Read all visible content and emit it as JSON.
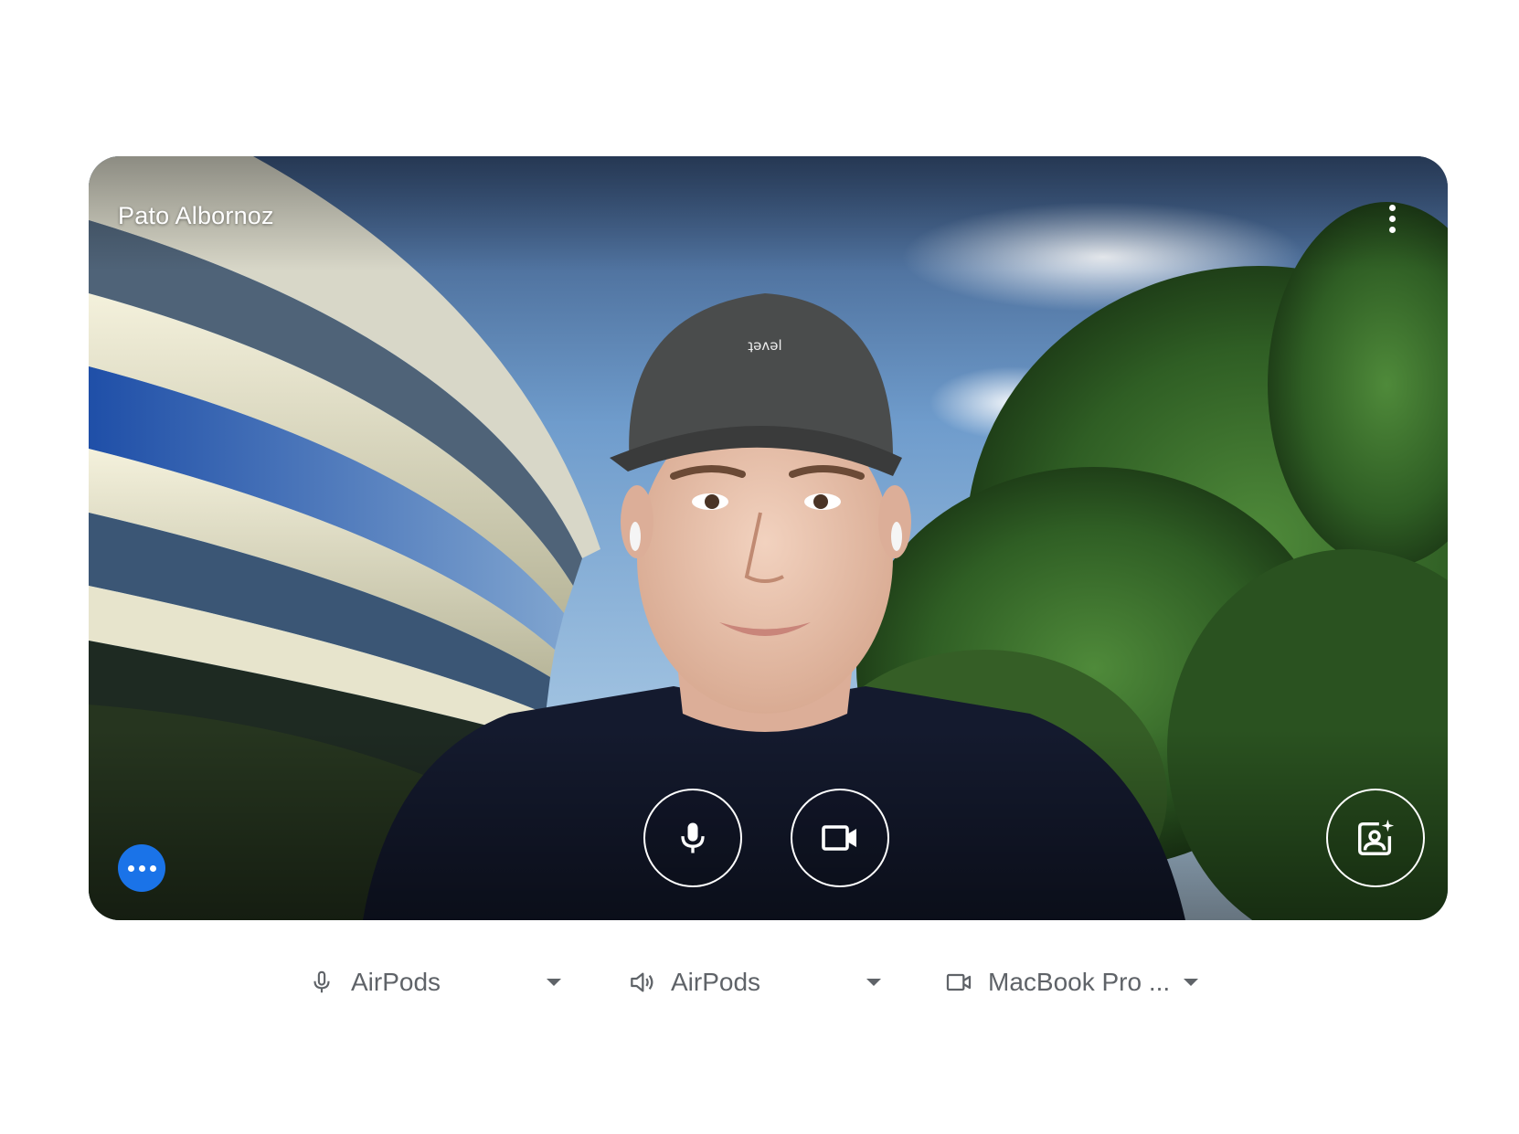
{
  "preview": {
    "participant_name": "Pato Albornoz",
    "more_options_icon": "more-vert-icon",
    "controls": {
      "mic_icon": "microphone-icon",
      "camera_icon": "videocam-icon",
      "effects_icon": "visual-effects-icon",
      "more_actions_icon": "more-horiz-icon"
    }
  },
  "devices": {
    "microphone": {
      "icon": "microphone-icon",
      "label": "AirPods"
    },
    "speaker": {
      "icon": "speaker-icon",
      "label": "AirPods"
    },
    "camera": {
      "icon": "videocam-icon",
      "label": "MacBook Pro ..."
    }
  },
  "colors": {
    "accent_blue": "#1a73e8",
    "device_text": "#5f6368"
  }
}
